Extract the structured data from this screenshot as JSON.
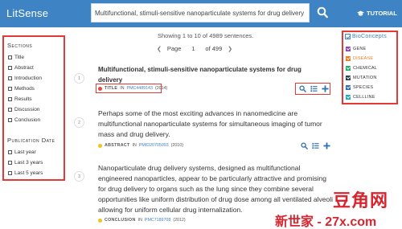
{
  "header": {
    "brand": "LitSense",
    "query": "Multifunctional, stimuli-sensitive nanoparticulate systems for drug delivery",
    "tutorial_label": "TUTORIAL"
  },
  "filters": {
    "sections_title": "Sections",
    "sections": [
      "Title",
      "Abstract",
      "Introduction",
      "Methods",
      "Results",
      "Discussion",
      "Conclusion"
    ],
    "date_title": "Publication Date",
    "dates": [
      "Last year",
      "Last 3 years",
      "Last 5 years"
    ]
  },
  "results_summary": "Showing 1 to 10 of 4989 sentences.",
  "pager": {
    "prev": "Page",
    "current": "1",
    "total": "of 499"
  },
  "results": [
    {
      "num": "1",
      "lines": [
        "Multifunctional, stimuli-sensitive nanoparticulate systems for drug",
        "delivery"
      ],
      "section": "TITLE",
      "in": "IN",
      "pmid": "PMC4489143",
      "year": "(2014)",
      "dot_color": "#e9463a"
    },
    {
      "num": "2",
      "lines": [
        "Perhaps some of the most exciting advances in nanomedicine are",
        "multifunctional nanoparticulate systems for simultaneous imaging of tumor",
        "mass and drug delivery."
      ],
      "section": "ABSTRACT",
      "in": "IN",
      "pmid": "PMID20705093",
      "year": "(2010)",
      "dot_color": "#f2c31b"
    },
    {
      "num": "3",
      "lines": [
        "Nanoparticulate drug delivery systems, designed as multifunctional",
        "engineered nanoparticles, appear to be particularly attractive and promising",
        "for drug delivery to organs such as the lung since they combine several",
        "opportunities like uniform distribution of drug dose among all ventilated alveoli",
        "allowing for uniform cellular drug internalization."
      ],
      "section": "CONCLUSION",
      "in": "IN",
      "pmid": "PMC7189708",
      "year": "(2012)",
      "dot_color": "#f2c31b"
    }
  ],
  "concepts": {
    "title": "BioConcepts",
    "items": [
      {
        "label": "GENE",
        "color": "#8e44ad"
      },
      {
        "label": "DISEASE",
        "color": "#e67e22"
      },
      {
        "label": "CHEMICAL",
        "color": "#27ae60"
      },
      {
        "label": "MUTATION",
        "color": "#2c3e50"
      },
      {
        "label": "SPECIES",
        "color": "#2f6fb3"
      },
      {
        "label": "CELLLINE",
        "color": "#27a7b8"
      }
    ]
  },
  "watermark": {
    "line1": "豆角网",
    "line2": "新世家 - 27x.com"
  },
  "colors": {
    "header": "#3e83c3",
    "highlight": "#e53935",
    "link": "#3e83c3"
  }
}
